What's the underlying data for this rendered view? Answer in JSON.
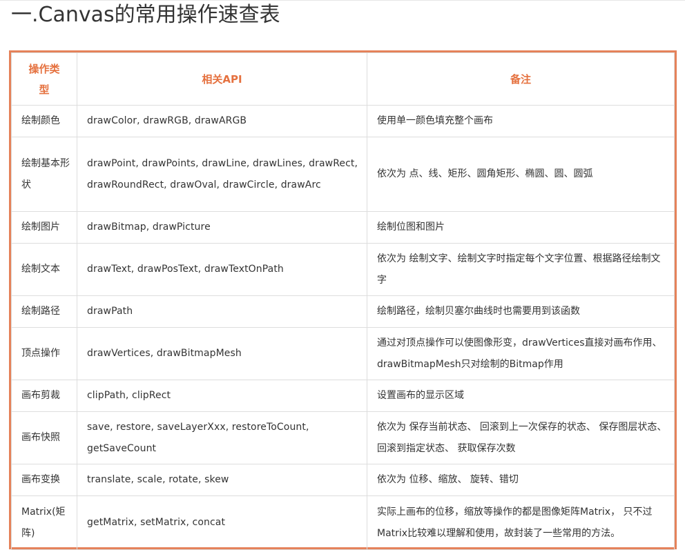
{
  "page": {
    "title": "一.Canvas的常用操作速查表"
  },
  "table": {
    "headers": {
      "type": "操作类型",
      "api": "相关API",
      "note": "备注"
    },
    "rows": [
      {
        "type": "绘制颜色",
        "api": "drawColor, drawRGB, drawARGB",
        "note": "使用单一颜色填充整个画布"
      },
      {
        "type": "绘制基本形状",
        "api": "drawPoint, drawPoints, drawLine, drawLines, drawRect, drawRoundRect, drawOval, drawCircle, drawArc",
        "note": "依次为 点、线、矩形、圆角矩形、椭圆、圆、圆弧"
      },
      {
        "type": "绘制图片",
        "api": "drawBitmap, drawPicture",
        "note": "绘制位图和图片"
      },
      {
        "type": "绘制文本",
        "api": "drawText, drawPosText, drawTextOnPath",
        "note": "依次为 绘制文字、绘制文字时指定每个文字位置、根据路径绘制文字"
      },
      {
        "type": "绘制路径",
        "api": "drawPath",
        "note": "绘制路径，绘制贝塞尔曲线时也需要用到该函数"
      },
      {
        "type": "顶点操作",
        "api": "drawVertices, drawBitmapMesh",
        "note": "通过对顶点操作可以使图像形变，drawVertices直接对画布作用、 drawBitmapMesh只对绘制的Bitmap作用"
      },
      {
        "type": "画布剪裁",
        "api": "clipPath, clipRect",
        "note": "设置画布的显示区域"
      },
      {
        "type": "画布快照",
        "api": "save, restore, saveLayerXxx, restoreToCount, getSaveCount",
        "note": "依次为 保存当前状态、 回滚到上一次保存的状态、 保存图层状态、 回滚到指定状态、 获取保存次数"
      },
      {
        "type": "画布变换",
        "api": "translate, scale, rotate, skew",
        "note": "依次为 位移、缩放、 旋转、错切"
      },
      {
        "type": "Matrix(矩阵)",
        "api": "getMatrix, setMatrix, concat",
        "note": "实际上画布的位移，缩放等操作的都是图像矩阵Matrix， 只不过Matrix比较难以理解和使用，故封装了一些常用的方法。"
      }
    ]
  },
  "colors": {
    "accent": "#e5825a",
    "header_text": "#e5713f",
    "cell_border": "#dddddd",
    "body_text": "#333333"
  }
}
